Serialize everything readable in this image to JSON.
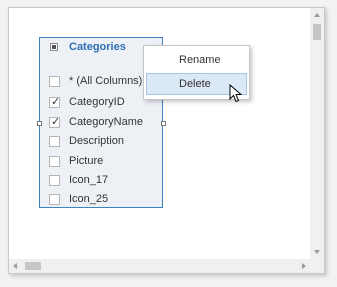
{
  "table": {
    "title": "Categories",
    "fields": [
      {
        "label": "* (All Columns)",
        "checked": false
      },
      {
        "label": "CategoryID",
        "checked": true
      },
      {
        "label": "CategoryName",
        "checked": true
      },
      {
        "label": "Description",
        "checked": false
      },
      {
        "label": "Picture",
        "checked": false
      },
      {
        "label": "Icon_17",
        "checked": false
      },
      {
        "label": "Icon_25",
        "checked": false
      }
    ]
  },
  "context_menu": {
    "rename_label": "Rename",
    "delete_label": "Delete"
  },
  "colors": {
    "title": "#2e6fb4",
    "table_border": "#3f82c4",
    "menu_highlight": "#dbe8f6"
  }
}
